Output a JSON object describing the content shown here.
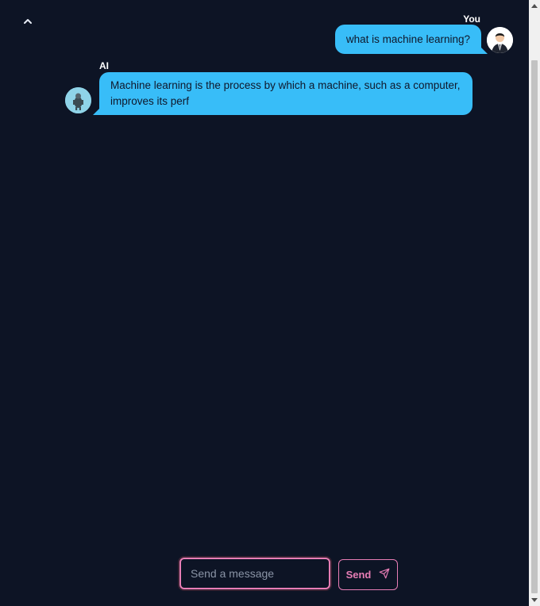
{
  "chat": {
    "messages": [
      {
        "author": "You",
        "text": "what is machine learning?",
        "avatar_icon": "user-avatar-icon"
      },
      {
        "author": "AI",
        "text": "Machine learning is the process by which a machine, such as a computer, improves its perf",
        "avatar_icon": "robot-avatar-icon"
      }
    ]
  },
  "composer": {
    "placeholder": "Send a message",
    "send_label": "Send",
    "send_icon": "send-icon"
  },
  "colors": {
    "background": "#0d1425",
    "bubble": "#38bdf8",
    "accent": "#e77db5"
  }
}
